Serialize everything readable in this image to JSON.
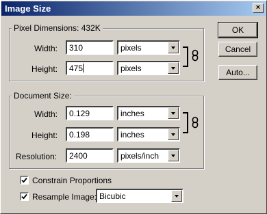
{
  "window": {
    "title": "Image Size",
    "close_glyph": "×"
  },
  "pixel_dimensions": {
    "legend": "Pixel Dimensions:",
    "size": "432K",
    "width_label": "Width:",
    "width_value": "310",
    "width_unit": "pixels",
    "height_label": "Height:",
    "height_value": "475",
    "height_unit": "pixels"
  },
  "document_size": {
    "legend": "Document Size:",
    "width_label": "Width:",
    "width_value": "0.129",
    "width_unit": "inches",
    "height_label": "Height:",
    "height_value": "0.198",
    "height_unit": "inches",
    "resolution_label": "Resolution:",
    "resolution_value": "2400",
    "resolution_unit": "pixels/inch"
  },
  "options": {
    "constrain_label": "Constrain Proportions",
    "constrain_checked": true,
    "resample_label": "Resample Image:",
    "resample_checked": true,
    "resample_method": "Bicubic"
  },
  "buttons": {
    "ok": "OK",
    "cancel": "Cancel",
    "auto": "Auto..."
  }
}
